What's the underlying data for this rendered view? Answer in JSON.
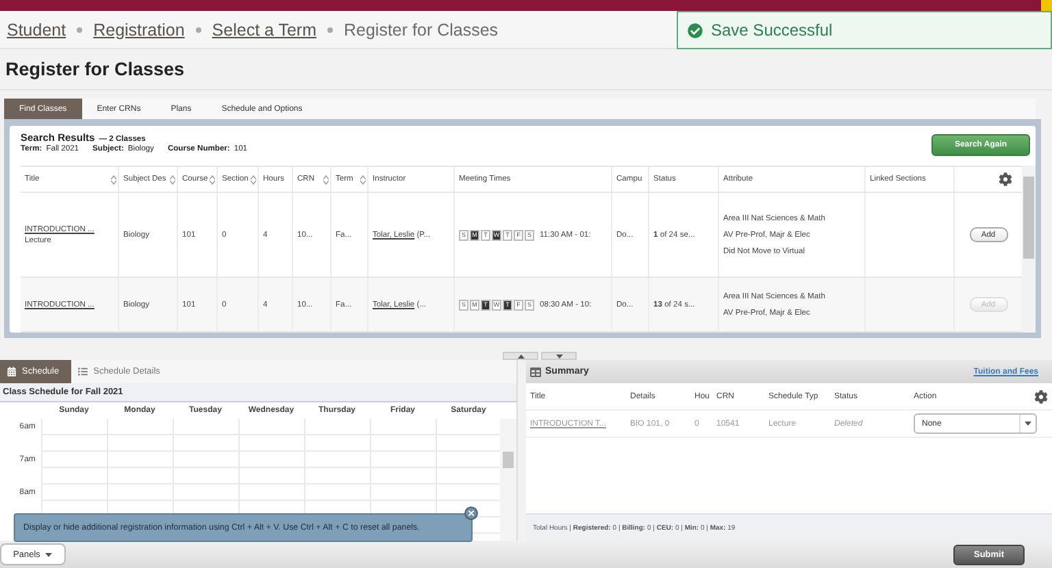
{
  "breadcrumb": [
    {
      "label": "Student",
      "link": true
    },
    {
      "label": "Registration",
      "link": true
    },
    {
      "label": "Select a Term",
      "link": true
    },
    {
      "label": "Register for Classes",
      "link": false
    }
  ],
  "toast": {
    "message": "Save Successful"
  },
  "page_title": "Register for Classes",
  "tabs": [
    {
      "label": "Find Classes",
      "selected": true
    },
    {
      "label": "Enter CRNs",
      "selected": false
    },
    {
      "label": "Plans",
      "selected": false
    },
    {
      "label": "Schedule and Options",
      "selected": false
    }
  ],
  "search_results": {
    "heading": "Search Results",
    "count": "— 2 Classes",
    "criteria": [
      {
        "label": "Term:",
        "value": "Fall 2021"
      },
      {
        "label": "Subject:",
        "value": "Biology"
      },
      {
        "label": "Course Number:",
        "value": "101"
      }
    ],
    "search_again": "Search Again",
    "columns": [
      {
        "label": "Title",
        "sortable": true
      },
      {
        "label": "Subject Des",
        "sortable": true
      },
      {
        "label": "Course",
        "sortable": true
      },
      {
        "label": "Section",
        "sortable": true
      },
      {
        "label": "Hours",
        "sortable": false
      },
      {
        "label": "CRN",
        "sortable": true
      },
      {
        "label": "Term",
        "sortable": true
      },
      {
        "label": "Instructor",
        "sortable": false
      },
      {
        "label": "Meeting Times",
        "sortable": false
      },
      {
        "label": "Campu",
        "sortable": false
      },
      {
        "label": "Status",
        "sortable": false
      },
      {
        "label": "Attribute",
        "sortable": false
      },
      {
        "label": "Linked Sections",
        "sortable": false
      }
    ],
    "rows": [
      {
        "title": "INTRODUCTION ...",
        "schedule_type": "Lecture",
        "subject": "Biology",
        "course": "101",
        "section": "0",
        "hours": "4",
        "crn": "10...",
        "term": "Fa...",
        "instructor": "Tolar, Leslie",
        "instructor_more": "(P...",
        "days": [
          {
            "letter": "S",
            "selected": false
          },
          {
            "letter": "M",
            "selected": true
          },
          {
            "letter": "T",
            "selected": false
          },
          {
            "letter": "W",
            "selected": true
          },
          {
            "letter": "T",
            "selected": false
          },
          {
            "letter": "F",
            "selected": false
          },
          {
            "letter": "S",
            "selected": false
          }
        ],
        "time": "11:30 AM - 01:",
        "campus": "Do...",
        "status": "**1** of 24 se...",
        "attributes": [
          "Area III Nat Sciences & Math",
          "AV Pre-Prof, Majr & Elec",
          "Did Not Move to Virtual"
        ],
        "add": {
          "label": "Add",
          "disabled": false
        }
      },
      {
        "title": "INTRODUCTION ...",
        "subject": "Biology",
        "course": "101",
        "section": "0",
        "hours": "4",
        "crn": "10...",
        "term": "Fa...",
        "instructor": "Tolar, Leslie",
        "instructor_more": "(...",
        "days": [
          {
            "letter": "S",
            "selected": false
          },
          {
            "letter": "M",
            "selected": false
          },
          {
            "letter": "T",
            "selected": true
          },
          {
            "letter": "W",
            "selected": false
          },
          {
            "letter": "T",
            "selected": true
          },
          {
            "letter": "F",
            "selected": false
          },
          {
            "letter": "S",
            "selected": false
          }
        ],
        "time": "08:30 AM - 10:",
        "campus": "Do...",
        "status": "**13** of 24 s...",
        "attributes": [
          "Area III Nat Sciences & Math",
          "AV Pre-Prof, Majr & Elec"
        ],
        "add": {
          "label": "Add",
          "disabled": true
        }
      }
    ]
  },
  "schedule_panel": {
    "tabs": [
      {
        "label": "Schedule",
        "selected": true
      },
      {
        "label": "Schedule Details",
        "selected": false
      }
    ],
    "heading": "Class Schedule for Fall 2021",
    "days": [
      "Sunday",
      "Monday",
      "Tuesday",
      "Wednesday",
      "Thursday",
      "Friday",
      "Saturday"
    ],
    "times": [
      "6am",
      "7am",
      "8am"
    ],
    "tip": "Display or hide additional registration information using Ctrl + Alt + V. Use Ctrl + Alt + C to reset all panels."
  },
  "summary": {
    "title": "Summary",
    "link": "Tuition and Fees",
    "columns": [
      "Title",
      "Details",
      "Hou",
      "CRN",
      "Schedule Typ",
      "Status",
      "Action"
    ],
    "rows": [
      {
        "title": "INTRODUCTION T...",
        "details": "BIO 101, 0",
        "hours": "0",
        "crn": "10541",
        "schedule_type": "Lecture",
        "status": "Deleted",
        "action": "None"
      }
    ],
    "totals": "Total Hours | **Registered:** 0 | **Billing:** 0 | **CEU:** 0 | **Min:** 0 | **Max:** 19"
  },
  "footer": {
    "panels": "Panels",
    "submit": "Submit"
  }
}
